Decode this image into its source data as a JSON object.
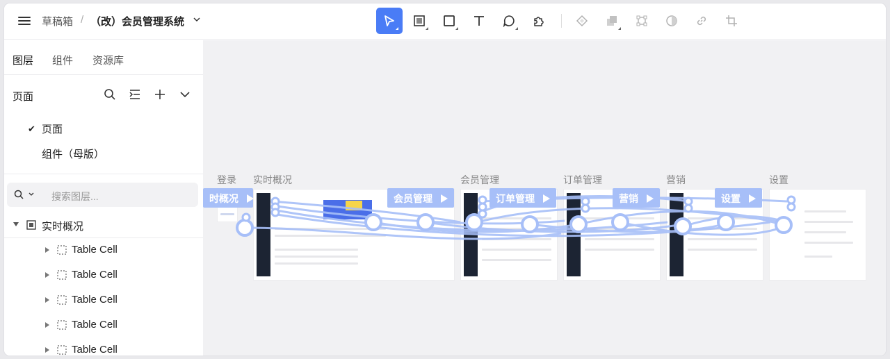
{
  "breadcrumb": {
    "drafts": "草稿箱",
    "separator": "/",
    "project": "（改）会员管理系统"
  },
  "toolbar": {
    "tools": [
      "select",
      "frame",
      "rectangle",
      "text",
      "comment",
      "plugin"
    ],
    "secondary": [
      "component",
      "boolean",
      "transform",
      "mask",
      "link",
      "crop"
    ]
  },
  "sidebar": {
    "tabs": [
      "图层",
      "组件",
      "资源库"
    ],
    "pages_title": "页面",
    "pages": [
      "页面",
      "组件（母版）"
    ],
    "search_placeholder": "搜索图层...",
    "root_layer": "实时概况",
    "layers": [
      "Table Cell",
      "Table Cell",
      "Table Cell",
      "Table Cell",
      "Table Cell"
    ]
  },
  "canvas": {
    "frames": [
      "登录",
      "实时概况",
      "会员管理",
      "订单管理",
      "营销",
      "设置"
    ],
    "flow_labels": [
      "时概况",
      "会员管理",
      "订单管理",
      "营销",
      "设置"
    ]
  },
  "colors": {
    "accent": "#4a7cf6",
    "flow": "#a7bff8",
    "nav_dark": "#1c2433"
  }
}
